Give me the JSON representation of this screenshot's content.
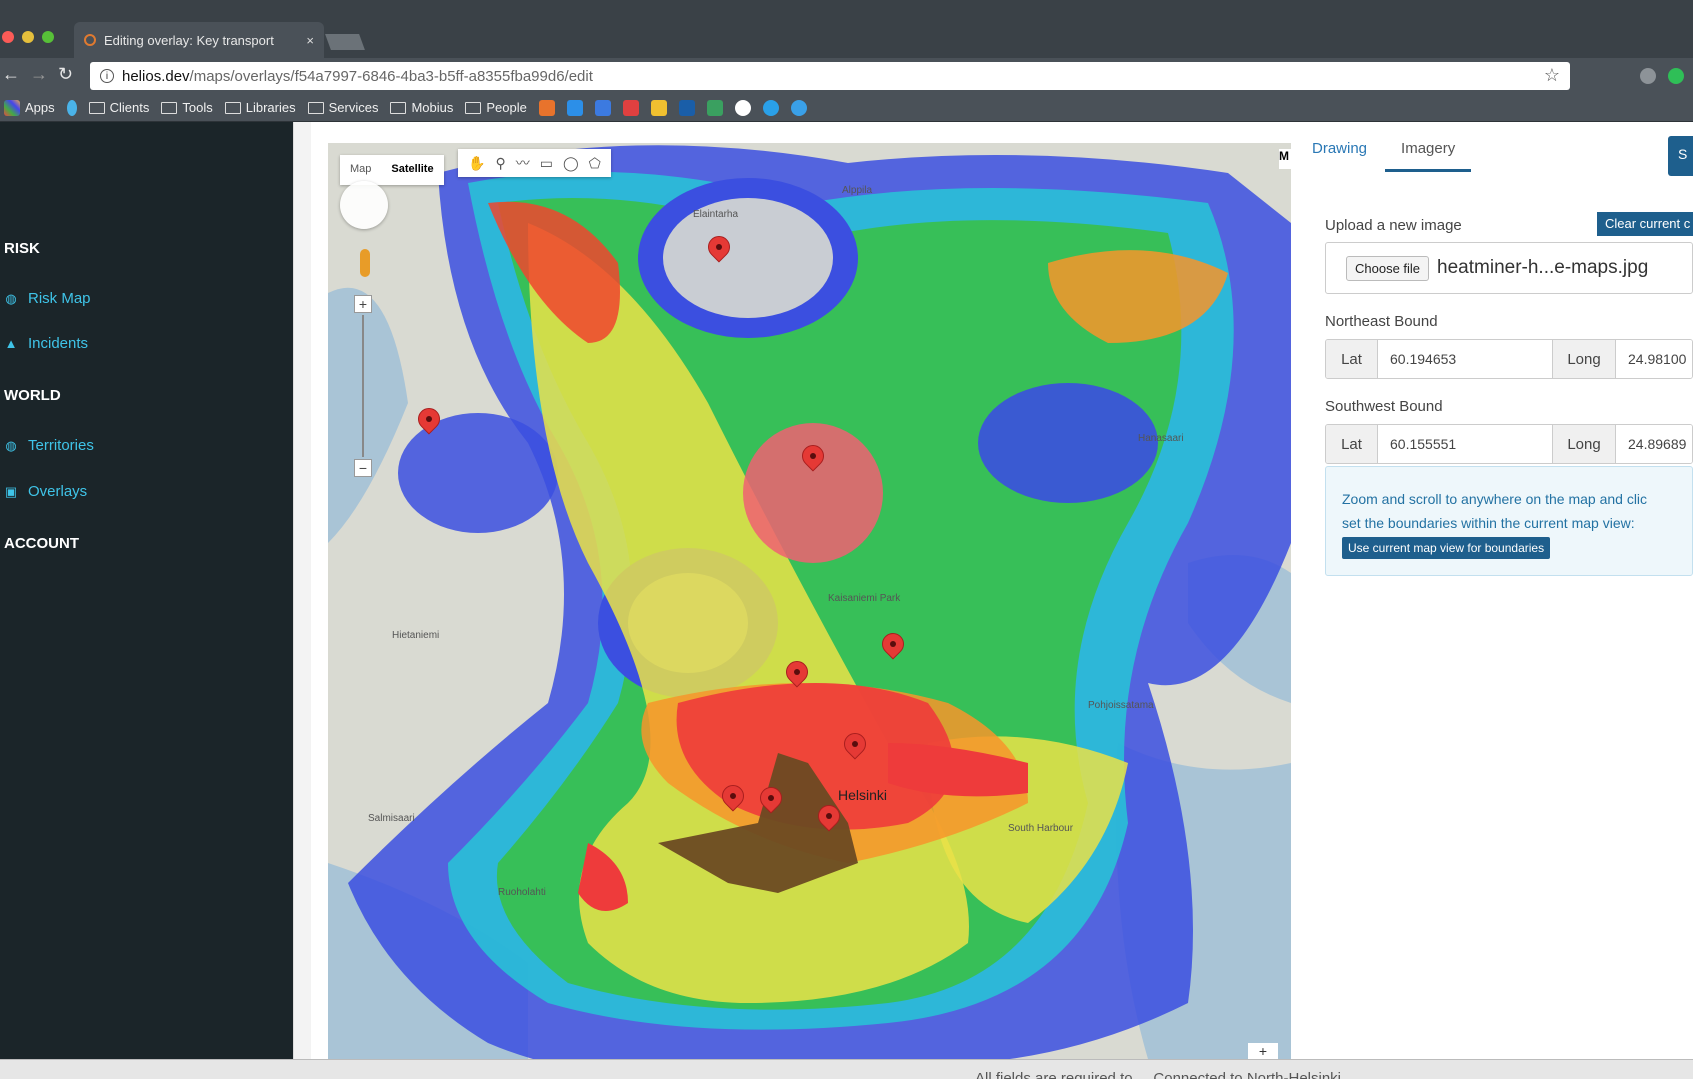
{
  "browser": {
    "tab_title": "Editing overlay: Key transport",
    "tab_close": "×",
    "url_host": "helios.dev",
    "url_path": "/maps/overlays/f54a7997-6846-4ba3-b5ff-a8355fba99d6/edit",
    "bookmarks": [
      "Apps",
      "Clients",
      "Tools",
      "Libraries",
      "Services",
      "Mobius",
      "People"
    ],
    "traffic_colors": [
      "#fc5b57",
      "#e5bf3c",
      "#57c038"
    ]
  },
  "sidebar": {
    "sections": [
      {
        "heading": "RISK",
        "items": [
          {
            "label": "Risk Map",
            "icon": "globe-icon"
          },
          {
            "label": "Incidents",
            "icon": "warning-icon"
          }
        ]
      },
      {
        "heading": "WORLD",
        "items": [
          {
            "label": "Territories",
            "icon": "globe-icon"
          },
          {
            "label": "Overlays",
            "icon": "image-icon"
          }
        ]
      },
      {
        "heading": "ACCOUNT",
        "items": []
      }
    ],
    "accent": "#3fc4e8"
  },
  "map": {
    "type_map": "Map",
    "type_satellite": "Satellite",
    "zoom_plus": "+",
    "zoom_minus": "−",
    "corner_label": "M",
    "labels": [
      "Elaintarha",
      "Alppila",
      "Helsinki",
      "Hietaniemi",
      "Kaisaniemi Park",
      "Pohjoissatama",
      "Ruoholahti",
      "South Harbour",
      "Hanasaari",
      "Salmisaari"
    ]
  },
  "panel": {
    "tabs": [
      "Drawing",
      "Imagery"
    ],
    "active_tab": "Imagery",
    "save_label": "S",
    "upload_label": "Upload a new image",
    "clear_label": "Clear current c",
    "choose_file": "Choose file",
    "file_name": "heatminer-h...e-maps.jpg",
    "ne_label": "Northeast Bound",
    "sw_label": "Southwest Bound",
    "lat_label": "Lat",
    "long_label": "Long",
    "ne_lat": "60.194653",
    "ne_long": "24.98100",
    "sw_lat": "60.155551",
    "sw_long": "24.89689",
    "info_line1": "Zoom and scroll to anywhere on the map and clic",
    "info_line2": "set the boundaries within the current map view:",
    "use_button": "Use current map view for boundaries",
    "accent": "#1e5f8d"
  },
  "footer": {
    "text": "All fields are required to ... Connected to North-Helsinki"
  }
}
